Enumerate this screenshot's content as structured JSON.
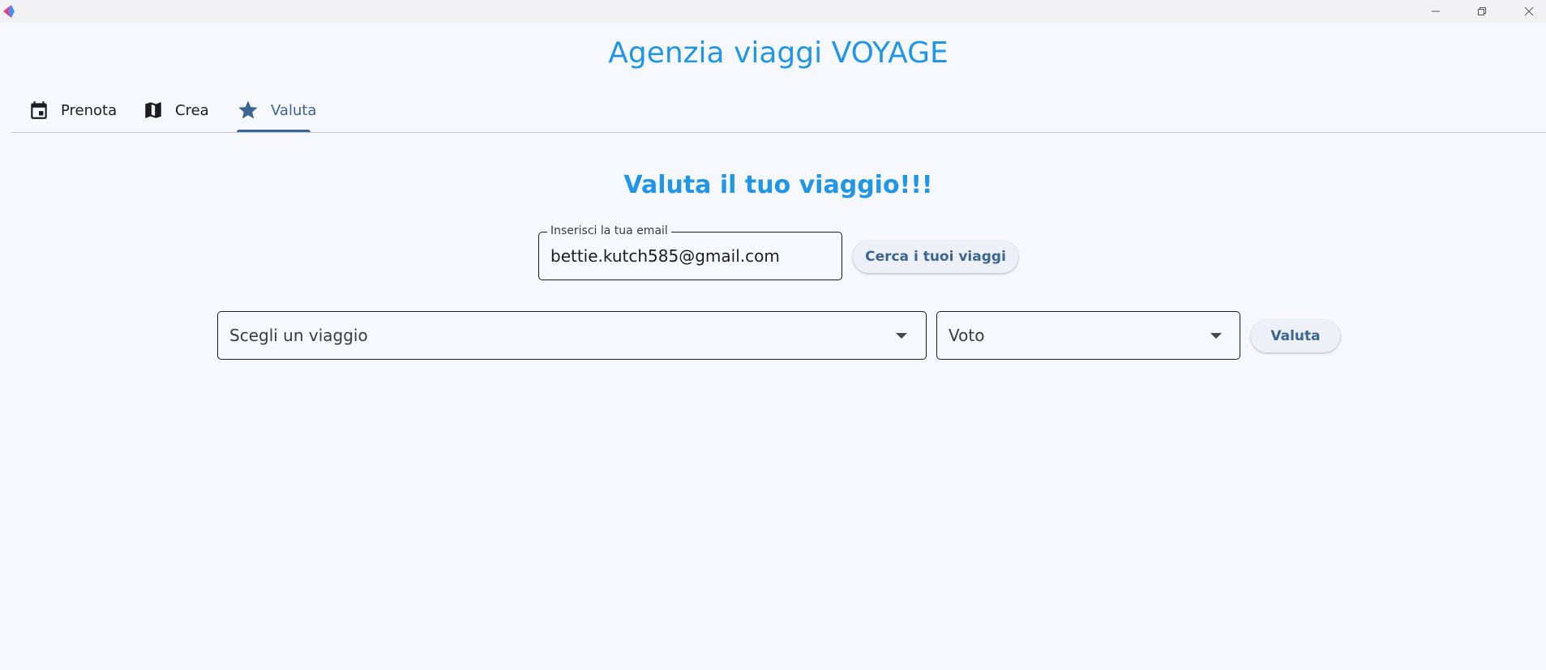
{
  "window": {
    "icons": {
      "logo": "app-logo-icon",
      "minimize": "minimize-icon",
      "maximize": "restore-icon",
      "close": "close-icon"
    }
  },
  "header": {
    "title": "Agenzia viaggi VOYAGE"
  },
  "tabs": [
    {
      "label": "Prenota",
      "icon": "calendar-icon",
      "active": false
    },
    {
      "label": "Crea",
      "icon": "map-icon",
      "active": false
    },
    {
      "label": "Valuta",
      "icon": "star-icon",
      "active": true
    }
  ],
  "colors": {
    "accent": "#2196e6",
    "primary": "#3b6592",
    "background": "#f7f8fd"
  },
  "valuta": {
    "title": "Valuta il tuo viaggio!!!",
    "email_field": {
      "label": "Inserisci la tua email",
      "value": "bettie.kutch585@gmail.com"
    },
    "search_button": "Cerca i tuoi viaggi",
    "trip_dropdown": {
      "placeholder": "Scegli un viaggio"
    },
    "vote_dropdown": {
      "placeholder": "Voto"
    },
    "rate_button": "Valuta"
  }
}
